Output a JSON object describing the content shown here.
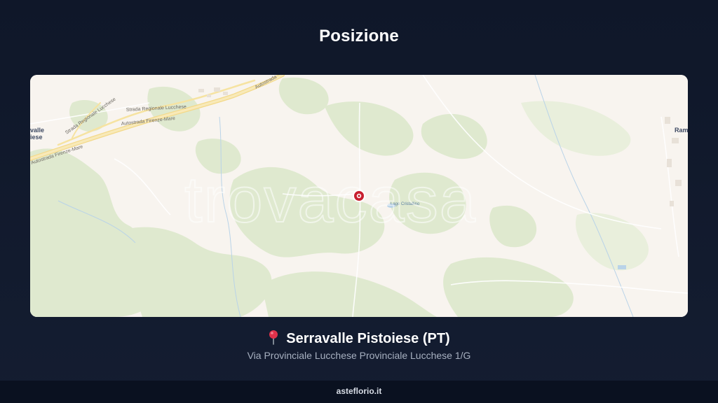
{
  "page": {
    "title": "Posizione"
  },
  "map": {
    "watermark": "trovacasa",
    "labels": {
      "strada_regionale_1": "Strada Regionale Lucchese",
      "strada_regionale_2": "Strada Regionale Lucchese",
      "autostrada_1": "Autostrada Firenze-Mare",
      "autostrada_2": "Autostrada Firenze-Mare",
      "autostrada_3": "Autostrada",
      "lago": "Lago Cristallino",
      "town_left_1": "valle",
      "town_left_2": "iese",
      "town_right": "Rami"
    },
    "marker_icon": "map-pin-icon"
  },
  "location": {
    "name": "Serravalle Pistoiese (PT)",
    "address": "Via Provinciale Lucchese Provinciale Lucchese 1/G",
    "icon": "pushpin-icon"
  },
  "footer": {
    "site": "asteflorio.it"
  },
  "colors": {
    "background": "#111a2c",
    "map_base": "#f8f4ef",
    "map_green": "#dde8cc",
    "road_yellow": "#f6e3a1",
    "marker_red": "#c8202f",
    "footer_bg": "#0a1120"
  }
}
